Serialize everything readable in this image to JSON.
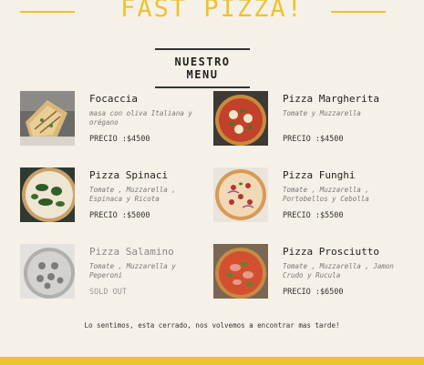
{
  "header": {
    "title": "FAST PIZZA!"
  },
  "menu": {
    "heading": "NUESTRO MENU",
    "items": [
      {
        "name": "Focaccia",
        "description": "masa con oliva Italiana y orégano",
        "price": "PRECIO :$4500",
        "image": "focaccia-photo"
      },
      {
        "name": "Pizza Margherita",
        "description": "Tomate y Muzzarella",
        "price": "PRECIO :$4500",
        "image": "margherita-photo"
      },
      {
        "name": "Pizza Spinaci",
        "description": "Tomate , Muzzarella , Espinaca y Ricota",
        "price": "PRECIO :$5000",
        "image": "spinaci-photo"
      },
      {
        "name": "Pizza Funghi",
        "description": "Tomate , Muzzarella , Portobellos y Cebolla",
        "price": "PRECIO :$5500",
        "image": "funghi-photo"
      },
      {
        "name": "Pizza Salamino",
        "description": "Tomate , Muzzarella y Peperoni",
        "price": "SOLD OUT",
        "image": "salamino-photo",
        "sold_out": true
      },
      {
        "name": "Pizza Prosciutto",
        "description": "Tomate , Muzzarella , Jamon Crudo y Rucula",
        "price": "PRECIO :$6500",
        "image": "prosciutto-photo"
      }
    ]
  },
  "footer": {
    "message": "Lo sentimos, esta cerrado, nos volvemos a encontrar mas tarde!"
  },
  "colors": {
    "accent": "#edc32d",
    "background": "#f6f1e8",
    "text": "#333333"
  }
}
